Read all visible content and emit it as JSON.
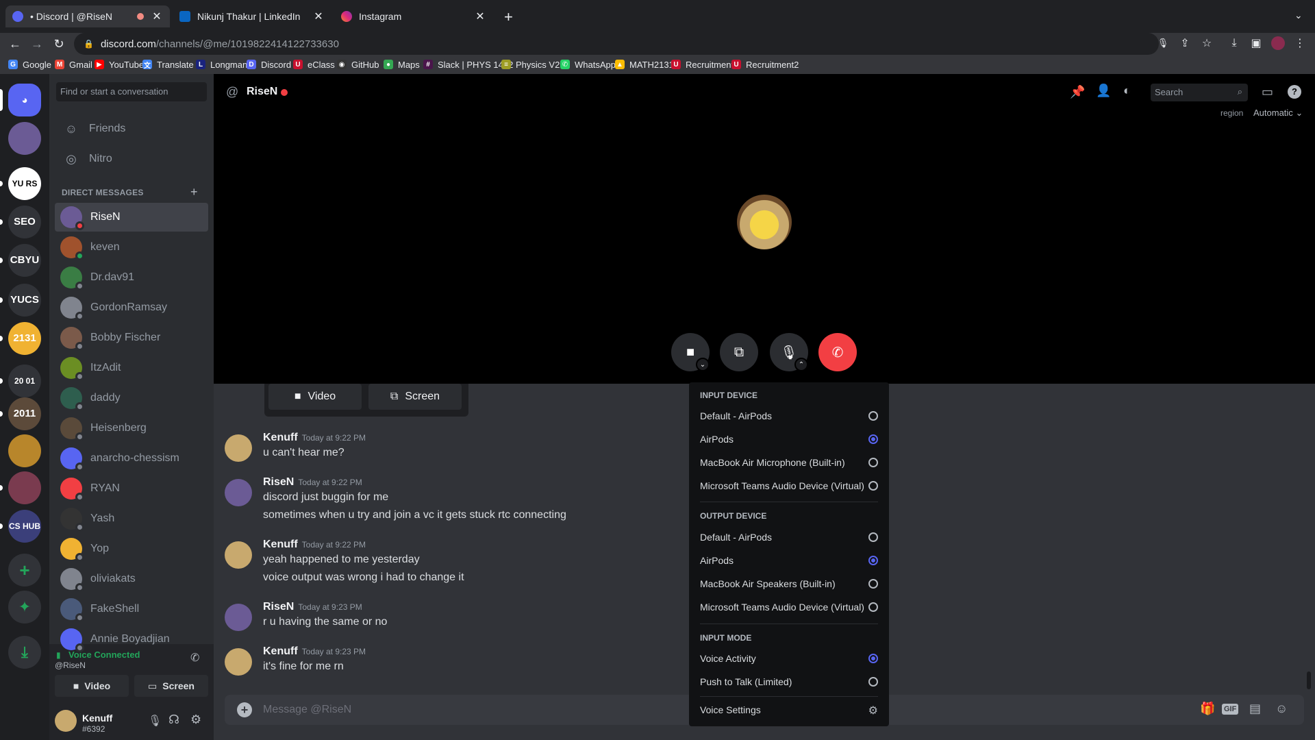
{
  "browser": {
    "tabs": [
      {
        "title": "• Discord | @RiseN",
        "fav_color": "#5865f2"
      },
      {
        "title": "Nikunj Thakur | LinkedIn",
        "fav_color": "#0a66c2"
      },
      {
        "title": "Instagram",
        "fav_color": "#e1306c"
      }
    ],
    "url_host": "discord.com",
    "url_path": "/channels/@me/1019822414122733630",
    "bookmarks": [
      {
        "label": "Google",
        "color": "#4285f4",
        "glyph": "G"
      },
      {
        "label": "Gmail",
        "color": "#ea4335",
        "glyph": "M"
      },
      {
        "label": "YouTube",
        "color": "#ff0000",
        "glyph": "▶"
      },
      {
        "label": "Translate",
        "color": "#4285f4",
        "glyph": "文"
      },
      {
        "label": "Longman",
        "color": "#1a237e",
        "glyph": "L"
      },
      {
        "label": "Discord",
        "color": "#5865f2",
        "glyph": "D"
      },
      {
        "label": "eClass",
        "color": "#c8102e",
        "glyph": "U"
      },
      {
        "label": "GitHub",
        "color": "#333333",
        "glyph": "◉"
      },
      {
        "label": "Maps",
        "color": "#34a853",
        "glyph": "●"
      },
      {
        "label": "Slack | PHYS 1412",
        "color": "#4a154b",
        "glyph": "#"
      },
      {
        "label": "Physics V2",
        "color": "#9e9d24",
        "glyph": "≡"
      },
      {
        "label": "WhatsApp",
        "color": "#25d366",
        "glyph": "✆"
      },
      {
        "label": "MATH2131",
        "color": "#fbbc04",
        "glyph": "▲"
      },
      {
        "label": "Recruitment",
        "color": "#c8102e",
        "glyph": "U"
      },
      {
        "label": "Recruitment2",
        "color": "#c8102e",
        "glyph": "U"
      }
    ]
  },
  "servers": [
    {
      "label": "",
      "color": "#5865f2",
      "icon": "discord"
    },
    {
      "label": "",
      "color": "#6b5b95",
      "icon": "avatar"
    },
    {
      "label": "YU RS",
      "color": "#ffffff",
      "text_color": "#000000"
    },
    {
      "label": "SEO",
      "color": "#313338"
    },
    {
      "label": "CBYU",
      "color": "#313338"
    },
    {
      "label": "YUCS",
      "color": "#313338"
    },
    {
      "label": "2131",
      "color": "#f0b232"
    },
    {
      "label": "20 01",
      "color": "#313338"
    },
    {
      "label": "2011",
      "color": "#5c4a3a"
    },
    {
      "label": "",
      "color": "#b8862b"
    },
    {
      "label": "",
      "color": "#7a3b4f"
    },
    {
      "label": "CS HUB",
      "color": "#3b3f7a"
    }
  ],
  "dm_search_placeholder": "Find or start a conversation",
  "nav": [
    {
      "label": "Friends",
      "icon": "friends-icon"
    },
    {
      "label": "Nitro",
      "icon": "nitro-icon"
    }
  ],
  "dm_header": "DIRECT MESSAGES",
  "dm_list": [
    {
      "name": "RiseN",
      "color": "#6b5b95",
      "status": "#f23f43"
    },
    {
      "name": "keven",
      "color": "#a0522d",
      "status": "#23a55a"
    },
    {
      "name": "Dr.dav91",
      "color": "#3a7d44",
      "status": "#80848e"
    },
    {
      "name": "GordonRamsay",
      "color": "#80848e",
      "status": "#80848e"
    },
    {
      "name": "Bobby Fischer",
      "color": "#7b5a4a",
      "status": "#80848e"
    },
    {
      "name": "ItzAdit",
      "color": "#6b8e23",
      "status": "#80848e"
    },
    {
      "name": "daddy",
      "color": "#2e5e4e",
      "status": "#80848e"
    },
    {
      "name": "Heisenberg",
      "color": "#5a4a3a",
      "status": "#80848e"
    },
    {
      "name": "anarcho-chessism",
      "color": "#5865f2",
      "status": "#80848e"
    },
    {
      "name": "RYAN",
      "color": "#f23f43",
      "status": "#80848e"
    },
    {
      "name": "Yash",
      "color": "#333333",
      "status": "#80848e"
    },
    {
      "name": "Yop",
      "color": "#f0b232",
      "status": "#80848e"
    },
    {
      "name": "oliviakats",
      "color": "#80848e",
      "status": "#80848e"
    },
    {
      "name": "FakeShell",
      "color": "#4a5a7a",
      "status": "#80848e"
    },
    {
      "name": "Annie Boyadjian",
      "color": "#5865f2",
      "status": "#80848e"
    }
  ],
  "voice": {
    "status": "Voice Connected",
    "channel": "@RiseN",
    "video_label": "Video",
    "screen_label": "Screen"
  },
  "user": {
    "name": "Kenuff",
    "tag": "#6392"
  },
  "channel": {
    "name": "RiseN",
    "search_placeholder": "Search",
    "region_label": "region",
    "region_value": "Automatic"
  },
  "call_bar": {
    "video_label": "Video",
    "screen_label": "Screen"
  },
  "messages": [
    {
      "author": "Kenuff",
      "time": "Today at 9:22 PM",
      "lines": [
        "u can't hear me?"
      ],
      "color": "#c8a96e"
    },
    {
      "author": "RiseN",
      "time": "Today at 9:22 PM",
      "lines": [
        "discord just buggin for me",
        "sometimes when u try and join a vc it gets stuck rtc connecting"
      ],
      "color": "#6b5b95"
    },
    {
      "author": "Kenuff",
      "time": "Today at 9:22 PM",
      "lines": [
        "yeah happened to me yesterday",
        "voice output was wrong i had to change it"
      ],
      "color": "#c8a96e"
    },
    {
      "author": "RiseN",
      "time": "Today at 9:23 PM",
      "lines": [
        "r u having the same or no"
      ],
      "color": "#6b5b95"
    },
    {
      "author": "Kenuff",
      "time": "Today at 9:23 PM",
      "lines": [
        "it's fine for me rn"
      ],
      "color": "#c8a96e"
    }
  ],
  "composer_placeholder": "Message @RiseN",
  "audio_menu": {
    "input_header": "INPUT DEVICE",
    "input_devices": [
      {
        "label": "Default - AirPods",
        "selected": false
      },
      {
        "label": "AirPods",
        "selected": true
      },
      {
        "label": "MacBook Air Microphone (Built-in)",
        "selected": false
      },
      {
        "label": "Microsoft Teams Audio Device (Virtual)",
        "selected": false
      }
    ],
    "output_header": "OUTPUT DEVICE",
    "output_devices": [
      {
        "label": "Default - AirPods",
        "selected": false
      },
      {
        "label": "AirPods",
        "selected": true
      },
      {
        "label": "MacBook Air Speakers (Built-in)",
        "selected": false
      },
      {
        "label": "Microsoft Teams Audio Device (Virtual)",
        "selected": false
      }
    ],
    "mode_header": "INPUT MODE",
    "input_modes": [
      {
        "label": "Voice Activity",
        "selected": true
      },
      {
        "label": "Push to Talk (Limited)",
        "selected": false
      }
    ],
    "settings_label": "Voice Settings"
  },
  "colors": {
    "accent": "#5865f2",
    "danger": "#f23f43",
    "online": "#23a55a"
  }
}
